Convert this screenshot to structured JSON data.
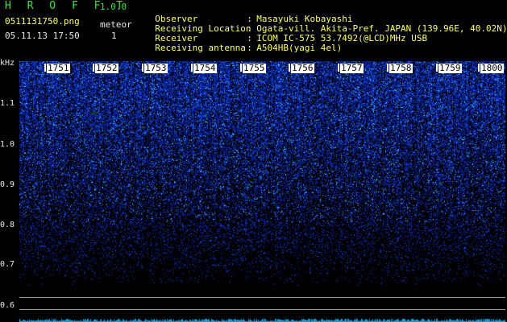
{
  "header": {
    "app_title": "H R O F F T",
    "app_version": "1.0.0",
    "file_name": "0511131750.png",
    "meteor_label": "meteor",
    "meteor_count": "1",
    "timestamp": "05.11.13 17:50"
  },
  "info": {
    "rows": [
      {
        "key": "Observer",
        "sep": ":",
        "value": "Masayuki Kobayashi"
      },
      {
        "key": "Receiving Location",
        "sep": ":",
        "value": "Ogata-vill. Akita-Pref. JAPAN (139.96E, 40.02N)"
      },
      {
        "key": "Receiver",
        "sep": ":",
        "value": "ICOM IC-575 53.7492(@LCD)MHz USB"
      },
      {
        "key": "Receiving antenna",
        "sep": ":",
        "value": "A504HB(yagi 4el)"
      }
    ]
  },
  "spectrogram": {
    "unit_label": "kHz",
    "y_ticks": [
      "1.1",
      "1.0",
      "0.9",
      "0.8",
      "0.7",
      "0.6"
    ],
    "time_labels": [
      "1751",
      "1752",
      "1753",
      "1754",
      "1755",
      "1756",
      "1757",
      "1758",
      "1759",
      "1800"
    ],
    "colors": {
      "background": "#000000",
      "signal_low": "#0a2aa0",
      "signal_high": "#5fd0ff"
    }
  }
}
